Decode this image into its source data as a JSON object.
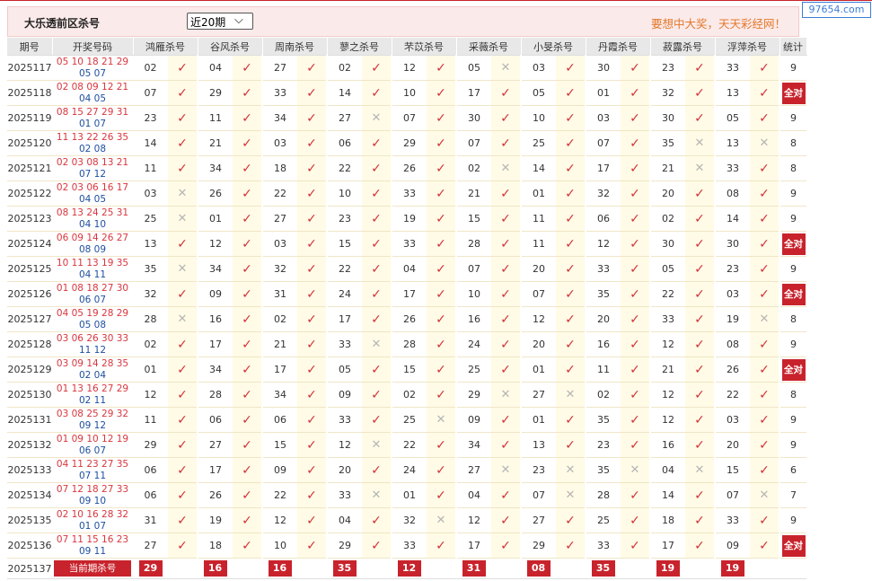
{
  "header": {
    "title": "大乐透前区杀号",
    "select_value": "近20期",
    "select_chevron": "⌵",
    "slogan": "要想中大奖，天天彩经网！"
  },
  "watermark": "97654.com",
  "columns": [
    "期号",
    "开奖号码",
    "鸿雁杀号",
    "谷风杀号",
    "周南杀号",
    "蓼之杀号",
    "芣苡杀号",
    "采薇杀号",
    "小旻杀号",
    "丹霞杀号",
    "菽露杀号",
    "浮萍杀号",
    "统计"
  ],
  "ok_glyph": "✓",
  "no_glyph": "✕",
  "all_correct_label": "全对",
  "rows": [
    {
      "period": "2025117",
      "front": "05 10 18 21 29",
      "back": "05 07",
      "picks": [
        [
          "02",
          1
        ],
        [
          "04",
          1
        ],
        [
          "27",
          1
        ],
        [
          "02",
          1
        ],
        [
          "12",
          1
        ],
        [
          "05",
          0
        ],
        [
          "03",
          1
        ],
        [
          "30",
          1
        ],
        [
          "23",
          1
        ],
        [
          "33",
          1
        ]
      ],
      "stat": "9"
    },
    {
      "period": "2025118",
      "front": "02 08 09 12 21",
      "back": "04 05",
      "picks": [
        [
          "07",
          1
        ],
        [
          "29",
          1
        ],
        [
          "33",
          1
        ],
        [
          "14",
          1
        ],
        [
          "10",
          1
        ],
        [
          "17",
          1
        ],
        [
          "05",
          1
        ],
        [
          "01",
          1
        ],
        [
          "32",
          1
        ],
        [
          "13",
          1
        ]
      ],
      "stat": "全对"
    },
    {
      "period": "2025119",
      "front": "08 15 27 29 31",
      "back": "01 07",
      "picks": [
        [
          "23",
          1
        ],
        [
          "11",
          1
        ],
        [
          "34",
          1
        ],
        [
          "27",
          0
        ],
        [
          "07",
          1
        ],
        [
          "30",
          1
        ],
        [
          "10",
          1
        ],
        [
          "03",
          1
        ],
        [
          "30",
          1
        ],
        [
          "05",
          1
        ]
      ],
      "stat": "9"
    },
    {
      "period": "2025120",
      "front": "11 13 22 26 35",
      "back": "02 08",
      "picks": [
        [
          "14",
          1
        ],
        [
          "21",
          1
        ],
        [
          "03",
          1
        ],
        [
          "06",
          1
        ],
        [
          "29",
          1
        ],
        [
          "07",
          1
        ],
        [
          "25",
          1
        ],
        [
          "07",
          1
        ],
        [
          "35",
          0
        ],
        [
          "13",
          0
        ]
      ],
      "stat": "8"
    },
    {
      "period": "2025121",
      "front": "02 03 08 13 21",
      "back": "07 12",
      "picks": [
        [
          "11",
          1
        ],
        [
          "34",
          1
        ],
        [
          "18",
          1
        ],
        [
          "22",
          1
        ],
        [
          "26",
          1
        ],
        [
          "02",
          0
        ],
        [
          "14",
          1
        ],
        [
          "17",
          1
        ],
        [
          "21",
          0
        ],
        [
          "33",
          1
        ]
      ],
      "stat": "8"
    },
    {
      "period": "2025122",
      "front": "02 03 06 16 17",
      "back": "04 05",
      "picks": [
        [
          "03",
          0
        ],
        [
          "26",
          1
        ],
        [
          "22",
          1
        ],
        [
          "10",
          1
        ],
        [
          "33",
          1
        ],
        [
          "21",
          1
        ],
        [
          "01",
          1
        ],
        [
          "32",
          1
        ],
        [
          "20",
          1
        ],
        [
          "08",
          1
        ]
      ],
      "stat": "9"
    },
    {
      "period": "2025123",
      "front": "08 13 24 25 31",
      "back": "04 10",
      "picks": [
        [
          "25",
          0
        ],
        [
          "01",
          1
        ],
        [
          "27",
          1
        ],
        [
          "23",
          1
        ],
        [
          "19",
          1
        ],
        [
          "15",
          1
        ],
        [
          "11",
          1
        ],
        [
          "06",
          1
        ],
        [
          "02",
          1
        ],
        [
          "14",
          1
        ]
      ],
      "stat": "9"
    },
    {
      "period": "2025124",
      "front": "06 09 14 26 27",
      "back": "08 09",
      "picks": [
        [
          "13",
          1
        ],
        [
          "12",
          1
        ],
        [
          "03",
          1
        ],
        [
          "15",
          1
        ],
        [
          "33",
          1
        ],
        [
          "28",
          1
        ],
        [
          "11",
          1
        ],
        [
          "12",
          1
        ],
        [
          "30",
          1
        ],
        [
          "30",
          1
        ]
      ],
      "stat": "全对"
    },
    {
      "period": "2025125",
      "front": "10 11 13 19 35",
      "back": "04 11",
      "picks": [
        [
          "35",
          0
        ],
        [
          "34",
          1
        ],
        [
          "32",
          1
        ],
        [
          "22",
          1
        ],
        [
          "04",
          1
        ],
        [
          "07",
          1
        ],
        [
          "20",
          1
        ],
        [
          "33",
          1
        ],
        [
          "05",
          1
        ],
        [
          "23",
          1
        ]
      ],
      "stat": "9"
    },
    {
      "period": "2025126",
      "front": "01 08 18 27 30",
      "back": "06 07",
      "picks": [
        [
          "32",
          1
        ],
        [
          "09",
          1
        ],
        [
          "31",
          1
        ],
        [
          "24",
          1
        ],
        [
          "17",
          1
        ],
        [
          "10",
          1
        ],
        [
          "07",
          1
        ],
        [
          "35",
          1
        ],
        [
          "22",
          1
        ],
        [
          "03",
          1
        ]
      ],
      "stat": "全对"
    },
    {
      "period": "2025127",
      "front": "04 05 19 28 29",
      "back": "05 08",
      "picks": [
        [
          "28",
          0
        ],
        [
          "16",
          1
        ],
        [
          "02",
          1
        ],
        [
          "17",
          1
        ],
        [
          "26",
          1
        ],
        [
          "16",
          1
        ],
        [
          "12",
          1
        ],
        [
          "20",
          1
        ],
        [
          "33",
          1
        ],
        [
          "19",
          0
        ]
      ],
      "stat": "8"
    },
    {
      "period": "2025128",
      "front": "03 06 26 30 33",
      "back": "11 12",
      "picks": [
        [
          "02",
          1
        ],
        [
          "17",
          1
        ],
        [
          "21",
          1
        ],
        [
          "33",
          0
        ],
        [
          "28",
          1
        ],
        [
          "24",
          1
        ],
        [
          "20",
          1
        ],
        [
          "16",
          1
        ],
        [
          "12",
          1
        ],
        [
          "08",
          1
        ]
      ],
      "stat": "9"
    },
    {
      "period": "2025129",
      "front": "03 09 14 28 35",
      "back": "02 04",
      "picks": [
        [
          "01",
          1
        ],
        [
          "34",
          1
        ],
        [
          "17",
          1
        ],
        [
          "05",
          1
        ],
        [
          "15",
          1
        ],
        [
          "25",
          1
        ],
        [
          "01",
          1
        ],
        [
          "11",
          1
        ],
        [
          "21",
          1
        ],
        [
          "26",
          1
        ]
      ],
      "stat": "全对"
    },
    {
      "period": "2025130",
      "front": "01 13 16 27 29",
      "back": "02 11",
      "picks": [
        [
          "12",
          1
        ],
        [
          "28",
          1
        ],
        [
          "34",
          1
        ],
        [
          "09",
          1
        ],
        [
          "02",
          1
        ],
        [
          "29",
          0
        ],
        [
          "27",
          0
        ],
        [
          "02",
          1
        ],
        [
          "12",
          1
        ],
        [
          "22",
          1
        ]
      ],
      "stat": "8"
    },
    {
      "period": "2025131",
      "front": "03 08 25 29 32",
      "back": "09 12",
      "picks": [
        [
          "11",
          1
        ],
        [
          "06",
          1
        ],
        [
          "06",
          1
        ],
        [
          "33",
          1
        ],
        [
          "25",
          0
        ],
        [
          "09",
          1
        ],
        [
          "01",
          1
        ],
        [
          "35",
          1
        ],
        [
          "12",
          1
        ],
        [
          "03",
          1
        ]
      ],
      "stat": "9"
    },
    {
      "period": "2025132",
      "front": "01 09 10 12 19",
      "back": "06 07",
      "picks": [
        [
          "29",
          1
        ],
        [
          "27",
          1
        ],
        [
          "15",
          1
        ],
        [
          "12",
          0
        ],
        [
          "22",
          1
        ],
        [
          "34",
          1
        ],
        [
          "13",
          1
        ],
        [
          "23",
          1
        ],
        [
          "16",
          1
        ],
        [
          "20",
          1
        ]
      ],
      "stat": "9"
    },
    {
      "period": "2025133",
      "front": "04 11 23 27 35",
      "back": "07 11",
      "picks": [
        [
          "06",
          1
        ],
        [
          "17",
          1
        ],
        [
          "09",
          1
        ],
        [
          "20",
          1
        ],
        [
          "24",
          1
        ],
        [
          "27",
          0
        ],
        [
          "23",
          0
        ],
        [
          "35",
          0
        ],
        [
          "04",
          0
        ],
        [
          "15",
          1
        ]
      ],
      "stat": "6"
    },
    {
      "period": "2025134",
      "front": "07 12 18 27 33",
      "back": "09 10",
      "picks": [
        [
          "06",
          1
        ],
        [
          "26",
          1
        ],
        [
          "22",
          1
        ],
        [
          "33",
          0
        ],
        [
          "01",
          1
        ],
        [
          "04",
          1
        ],
        [
          "07",
          0
        ],
        [
          "28",
          1
        ],
        [
          "14",
          1
        ],
        [
          "07",
          0
        ]
      ],
      "stat": "7"
    },
    {
      "period": "2025135",
      "front": "02 10 16 28 32",
      "back": "01 07",
      "picks": [
        [
          "31",
          1
        ],
        [
          "19",
          1
        ],
        [
          "12",
          1
        ],
        [
          "04",
          1
        ],
        [
          "32",
          0
        ],
        [
          "12",
          1
        ],
        [
          "27",
          1
        ],
        [
          "25",
          1
        ],
        [
          "18",
          1
        ],
        [
          "33",
          1
        ]
      ],
      "stat": "9"
    },
    {
      "period": "2025136",
      "front": "07 11 15 16 23",
      "back": "09 11",
      "picks": [
        [
          "27",
          1
        ],
        [
          "18",
          1
        ],
        [
          "10",
          1
        ],
        [
          "29",
          1
        ],
        [
          "33",
          1
        ],
        [
          "17",
          1
        ],
        [
          "29",
          1
        ],
        [
          "33",
          1
        ],
        [
          "17",
          1
        ],
        [
          "09",
          1
        ]
      ],
      "stat": "全对"
    }
  ],
  "current": {
    "period": "2025137",
    "label": "当前期杀号",
    "values": [
      "29",
      "16",
      "16",
      "35",
      "12",
      "31",
      "08",
      "35",
      "19",
      "19"
    ]
  }
}
